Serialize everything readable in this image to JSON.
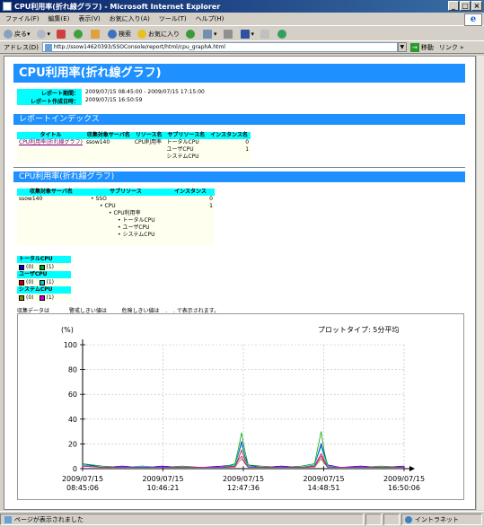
{
  "window": {
    "title": "CPU利用率(折れ線グラフ) - Microsoft Internet Explorer",
    "controls": [
      "_",
      "□",
      "×"
    ]
  },
  "menu": [
    "ファイル(F)",
    "編集(E)",
    "表示(V)",
    "お気に入り(A)",
    "ツール(T)",
    "ヘルプ(H)"
  ],
  "toolbar": {
    "back": "戻る",
    "search": "検索",
    "favorites": "お気に入り"
  },
  "address": {
    "label": "アドレス(D)",
    "url": "http://ssow14620393/SSOConsole/report/html/cpu_graphA.html",
    "go": "移動",
    "links": "リンク »"
  },
  "page": {
    "title": "CPU利用率(折れ線グラフ)",
    "period_label": "レポート期間：",
    "period_value": "2009/07/15 08:45:00 - 2009/07/15 17:15:00",
    "created_label": "レポート作成日時：",
    "created_value": "2009/07/15 16:50:59"
  },
  "index": {
    "heading": "レポートインデックス",
    "columns": [
      "タイトル",
      "収集対象サーバ名",
      "リソース名",
      "サブリソース名",
      "インスタンス名"
    ],
    "row": {
      "title": "CPU利用率(折れ線グラフ)",
      "server": "ssow140",
      "resource": "CPU利用率",
      "subresources": [
        "トータルCPU",
        "ユーザCPU",
        "システムCPU"
      ],
      "instances": [
        "0",
        "1",
        ""
      ]
    }
  },
  "section": {
    "heading": "CPU利用率(折れ線グラフ)",
    "columns": [
      "収集対象サーバ名",
      "サブリソース",
      "インスタンス"
    ],
    "server": "ssow140",
    "tree": {
      "root": "SSO",
      "l1": "CPU",
      "l2": "CPU利用率",
      "leaves": [
        "トータルCPU",
        "ユーザCPU",
        "システムCPU"
      ]
    },
    "instances": [
      "0",
      "1"
    ]
  },
  "legend": [
    {
      "name": "トータルCPU",
      "items": [
        {
          "label": "(0)",
          "color": "#0000cc"
        },
        {
          "label": "(1)",
          "color": "#00aa00"
        }
      ]
    },
    {
      "name": "ユーザCPU",
      "items": [
        {
          "label": "(0)",
          "color": "#cc0000"
        },
        {
          "label": "(1)",
          "color": "#00cccc"
        }
      ]
    },
    {
      "name": "システムCPU",
      "items": [
        {
          "label": "(0)",
          "color": "#888800"
        },
        {
          "label": "(1)",
          "color": "#cc00cc"
        }
      ]
    }
  ],
  "note": "収集データは ______ 警戒しきい値は _ _ _ 危険しきい値は _ . _ . で表示されます。",
  "chart_data": {
    "type": "line",
    "ylabel": "(%)",
    "annotation": "プロットタイプ: 5分平均",
    "ylim": [
      0,
      100
    ],
    "yticks": [
      0,
      20,
      40,
      60,
      80,
      100
    ],
    "xlim": [
      "2009/07/15 08:45:06",
      "2009/07/15 16:50:06"
    ],
    "xticks": [
      {
        "x": "2009/07/15 08:45:06",
        "date": "2009/07/15",
        "time": "08:45:06"
      },
      {
        "x": "2009/07/15 10:46:21",
        "date": "2009/07/15",
        "time": "10:46:21"
      },
      {
        "x": "2009/07/15 12:47:36",
        "date": "2009/07/15",
        "time": "12:47:36"
      },
      {
        "x": "2009/07/15 14:48:51",
        "date": "2009/07/15",
        "time": "14:48:51"
      },
      {
        "x": "2009/07/15 16:50:06",
        "date": "2009/07/15",
        "time": "16:50:06"
      }
    ],
    "x": [
      "2009/07/15 08:45",
      "2009/07/15 09:15",
      "2009/07/15 09:45",
      "2009/07/15 10:15",
      "2009/07/15 10:45",
      "2009/07/15 11:15",
      "2009/07/15 11:45",
      "2009/07/15 12:15",
      "2009/07/15 12:35",
      "2009/07/15 12:40",
      "2009/07/15 12:45",
      "2009/07/15 12:50",
      "2009/07/15 12:55",
      "2009/07/15 13:15",
      "2009/07/15 13:45",
      "2009/07/15 14:15",
      "2009/07/15 14:35",
      "2009/07/15 14:45",
      "2009/07/15 14:50",
      "2009/07/15 14:55",
      "2009/07/15 15:15",
      "2009/07/15 15:45",
      "2009/07/15 16:15",
      "2009/07/15 16:50"
    ],
    "series": [
      {
        "color": "#0000cc",
        "values": [
          4,
          1,
          2,
          1,
          2,
          1,
          1,
          2,
          3,
          12,
          22,
          10,
          3,
          1,
          2,
          1,
          3,
          20,
          11,
          3,
          1,
          2,
          1,
          2
        ]
      },
      {
        "color": "#00aa00",
        "values": [
          4,
          2,
          1,
          2,
          1,
          2,
          1,
          1,
          4,
          16,
          29,
          14,
          3,
          2,
          1,
          2,
          4,
          30,
          13,
          2,
          1,
          1,
          2,
          1
        ]
      },
      {
        "color": "#cc0000",
        "values": [
          3,
          1,
          1,
          1,
          1,
          1,
          1,
          1,
          2,
          8,
          15,
          7,
          2,
          1,
          1,
          1,
          2,
          12,
          6,
          2,
          1,
          1,
          1,
          1
        ]
      },
      {
        "color": "#00cccc",
        "values": [
          3,
          1,
          1,
          2,
          1,
          1,
          1,
          1,
          3,
          11,
          20,
          9,
          2,
          1,
          1,
          1,
          3,
          18,
          8,
          2,
          1,
          1,
          1,
          1
        ]
      },
      {
        "color": "#888800",
        "values": [
          2,
          1,
          1,
          1,
          1,
          1,
          1,
          1,
          1,
          5,
          8,
          4,
          1,
          1,
          1,
          1,
          1,
          8,
          4,
          1,
          1,
          1,
          1,
          1
        ]
      },
      {
        "color": "#cc00cc",
        "values": [
          2,
          1,
          1,
          1,
          1,
          1,
          1,
          1,
          2,
          7,
          10,
          5,
          1,
          1,
          1,
          1,
          2,
          10,
          5,
          1,
          1,
          1,
          1,
          1
        ]
      }
    ],
    "grid": true
  },
  "status": {
    "text": "ページが表示されました",
    "zone": "イントラネット"
  }
}
